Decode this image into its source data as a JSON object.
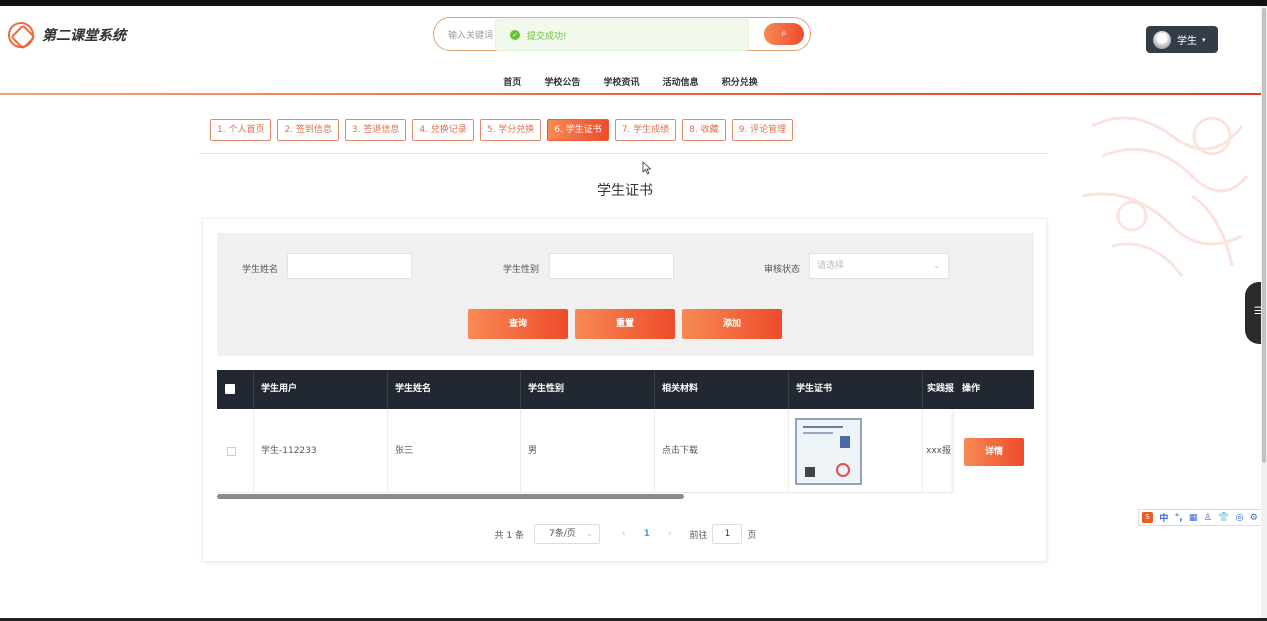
{
  "app": {
    "title": "第二课堂系统"
  },
  "search": {
    "placeholder": "输入关键词",
    "button_icon": "search-icon"
  },
  "toast": {
    "text": "提交成功!",
    "type": "success"
  },
  "nav": {
    "items": [
      "首页",
      "学校公告",
      "学校资讯",
      "活动信息",
      "积分兑换"
    ]
  },
  "user": {
    "name": "学生",
    "caret": "▾"
  },
  "tabs": [
    {
      "label": "1. 个人首页",
      "active": false
    },
    {
      "label": "2. 签到信息",
      "active": false
    },
    {
      "label": "3. 签退信息",
      "active": false
    },
    {
      "label": "4. 兑换记录",
      "active": false
    },
    {
      "label": "5. 学分兑换",
      "active": false
    },
    {
      "label": "6. 学生证书",
      "active": true
    },
    {
      "label": "7. 学生成绩",
      "active": false
    },
    {
      "label": "8. 收藏",
      "active": false
    },
    {
      "label": "9. 评论管理",
      "active": false
    }
  ],
  "page": {
    "title": "学生证书"
  },
  "filter": {
    "name_label": "学生姓名",
    "gender_label": "学生性别",
    "status_label": "审核状态",
    "status_placeholder": "请选择",
    "query_button": "查询",
    "reset_button": "重置",
    "add_button": "添加"
  },
  "table": {
    "headers": [
      "学生用户",
      "学生姓名",
      "学生性别",
      "相关材料",
      "学生证书",
      "实践报",
      "操作"
    ],
    "rows": [
      {
        "user": "学生-112233",
        "name": "张三",
        "gender": "男",
        "material": "点击下载",
        "report": "xxx报",
        "action": "详情"
      }
    ]
  },
  "pagination": {
    "total": "共 1 条",
    "page_size": "7条/页",
    "prev": "‹",
    "current": "1",
    "next": "›",
    "goto_label": "前往",
    "goto_value": "1",
    "goto_suffix": "页"
  },
  "ime": {
    "items": [
      "中",
      "°,",
      "▦",
      "♙",
      "👕",
      "◎",
      "⚙"
    ]
  },
  "colors": {
    "accent": "#ee4b2b",
    "accent_light": "#f78a55",
    "dark": "#222831",
    "success": "#67c23a"
  }
}
